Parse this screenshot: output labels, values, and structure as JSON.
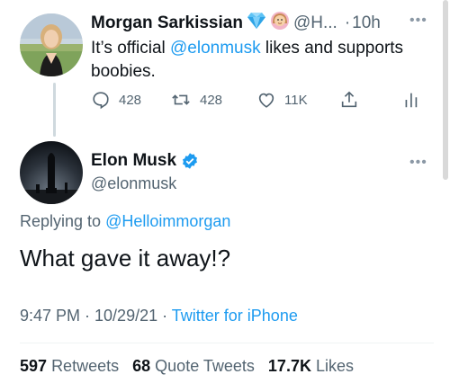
{
  "parent_tweet": {
    "author_name": "Morgan Sarkissian",
    "handle": "@H...",
    "time": "10h",
    "separator": "·",
    "text_prefix": "It’s official ",
    "mention": "@elonmusk",
    "text_suffix": " likes and supports boobies.",
    "replies": "428",
    "retweets": "428",
    "likes": "11K"
  },
  "main_tweet": {
    "author_name": "Elon Musk",
    "handle": "@elonmusk",
    "replying_prefix": "Replying to ",
    "replying_to": "@Helloimmorgan",
    "text": "What gave it away!?",
    "time_date": "9:47 PM · 10/29/21 · ",
    "source": "Twitter for iPhone"
  },
  "stats": {
    "retweets_count": "597",
    "retweets_label": "Retweets",
    "quotes_count": "68",
    "quotes_label": "Quote Tweets",
    "likes_count": "17.7K",
    "likes_label": "Likes"
  },
  "icons": {
    "reply": "comment-icon",
    "retweet": "retweet-icon",
    "like": "heart-icon",
    "share": "share-icon",
    "analytics": "analytics-icon",
    "verified": "verified-badge-icon",
    "gem": "gem-emoji-icon",
    "woman": "woman-emoji-icon",
    "more": "more-icon"
  },
  "colors": {
    "link": "#1d9bf0",
    "secondary": "#536471",
    "primary": "#0f1419"
  }
}
